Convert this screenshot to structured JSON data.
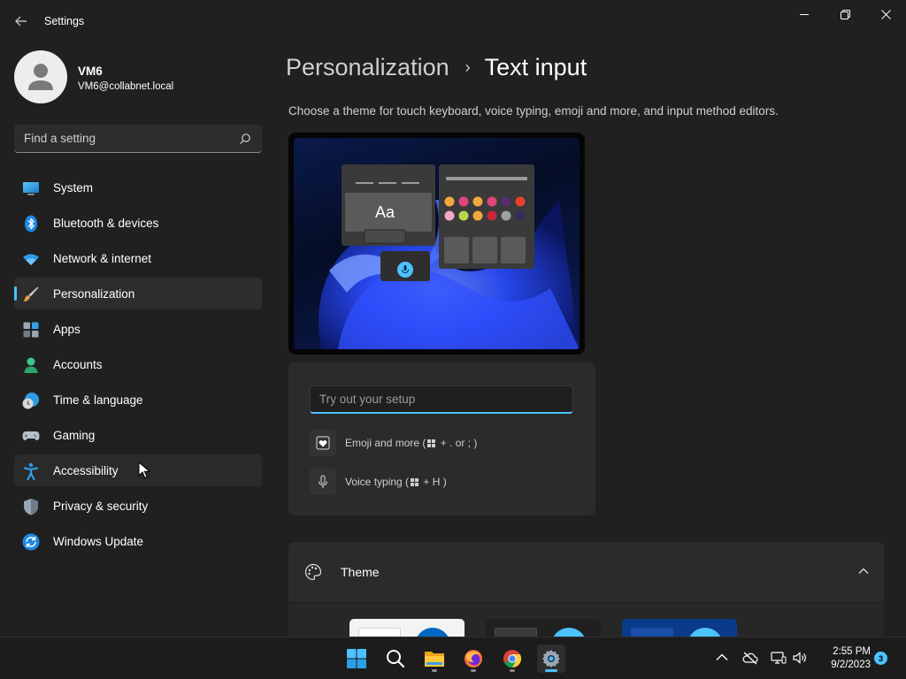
{
  "window": {
    "app_title": "Settings",
    "controls": [
      "minimize",
      "restore",
      "close"
    ]
  },
  "user": {
    "name": "VM6",
    "email": "VM6@collabnet.local"
  },
  "search": {
    "placeholder": "Find a setting",
    "value": ""
  },
  "sidebar": {
    "items": [
      {
        "label": "System",
        "icon": "system-icon"
      },
      {
        "label": "Bluetooth & devices",
        "icon": "bluetooth-icon"
      },
      {
        "label": "Network & internet",
        "icon": "wifi-icon"
      },
      {
        "label": "Personalization",
        "icon": "brush-icon",
        "selected": true
      },
      {
        "label": "Apps",
        "icon": "apps-icon"
      },
      {
        "label": "Accounts",
        "icon": "person-icon"
      },
      {
        "label": "Time & language",
        "icon": "clock-globe-icon"
      },
      {
        "label": "Gaming",
        "icon": "gamepad-icon"
      },
      {
        "label": "Accessibility",
        "icon": "accessibility-icon",
        "hovered": true
      },
      {
        "label": "Privacy & security",
        "icon": "shield-icon"
      },
      {
        "label": "Windows Update",
        "icon": "update-icon"
      }
    ]
  },
  "main": {
    "breadcrumb_parent": "Personalization",
    "breadcrumb_current": "Text input",
    "description": "Choose a theme for touch keyboard, voice typing, emoji and more, and input method editors.",
    "preview": {
      "sample_text": "Aa",
      "emoji_colors": [
        "#f2a93b",
        "#e0457b",
        "#f2a93b",
        "#e0457b",
        "#5a2d6e",
        "#e8402d",
        "#f2a8c3",
        "#b8d74b",
        "#f2a93b",
        "#c8283a",
        "#a0a0a0",
        "#3a2c5a"
      ]
    },
    "try_it": {
      "placeholder": "Try out your setup",
      "value": "",
      "emoji_prefix": "Emoji and more (",
      "emoji_suffix": " + . or ; )",
      "voice_prefix": "Voice typing (",
      "voice_suffix": " + H )"
    },
    "theme_section": {
      "label": "Theme",
      "expanded": true
    }
  },
  "taskbar": {
    "apps": [
      "start-icon",
      "search-icon",
      "file-explorer-icon",
      "firefox-icon",
      "chrome-icon",
      "settings-icon"
    ],
    "time": "2:55 PM",
    "date": "9/2/2023",
    "notification_count": "3"
  },
  "colors": {
    "accent": "#4cc2ff",
    "background": "#202020",
    "card": "#2b2b2b"
  }
}
